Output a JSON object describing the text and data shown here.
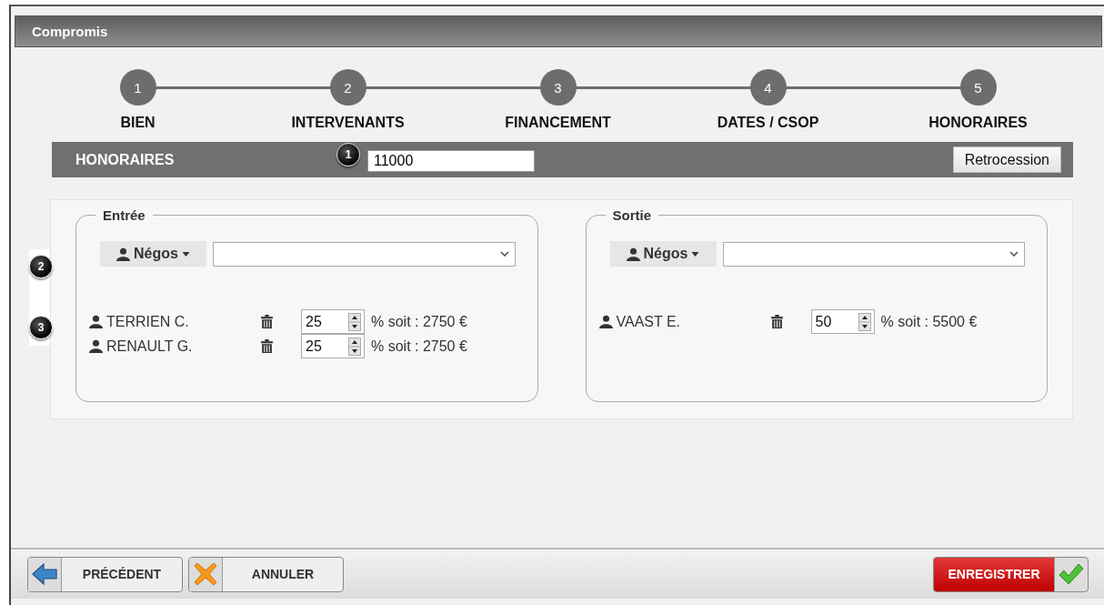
{
  "window": {
    "title": "Compromis"
  },
  "steps": [
    {
      "number": "1",
      "label": "BIEN"
    },
    {
      "number": "2",
      "label": "INTERVENANTS"
    },
    {
      "number": "3",
      "label": "FINANCEMENT"
    },
    {
      "number": "4",
      "label": "DATES / CSOP"
    },
    {
      "number": "5",
      "label": "HONORAIRES"
    }
  ],
  "honoraires": {
    "title": "HONORAIRES",
    "marker": "1",
    "value": "11000",
    "button": "Retrocession"
  },
  "markers": [
    "2",
    "3"
  ],
  "sections": [
    {
      "title": "Entrée",
      "negos": "Négos",
      "people": [
        {
          "name": "TERRIEN C.",
          "percent": "25",
          "amount": "% soit : 2750 €"
        },
        {
          "name": "RENAULT G.",
          "percent": "25",
          "amount": "% soit : 2750 €"
        }
      ]
    },
    {
      "title": "Sortie",
      "negos": "Négos",
      "people": [
        {
          "name": "VAAST E.",
          "percent": "50",
          "amount": "% soit : 5500 €"
        }
      ]
    }
  ],
  "footer": [
    {
      "kind": "back",
      "label": "PRÉCÉDENT"
    },
    {
      "kind": "cancel",
      "label": "ANNULER"
    },
    {
      "kind": "save",
      "label": "ENREGISTRER"
    }
  ]
}
